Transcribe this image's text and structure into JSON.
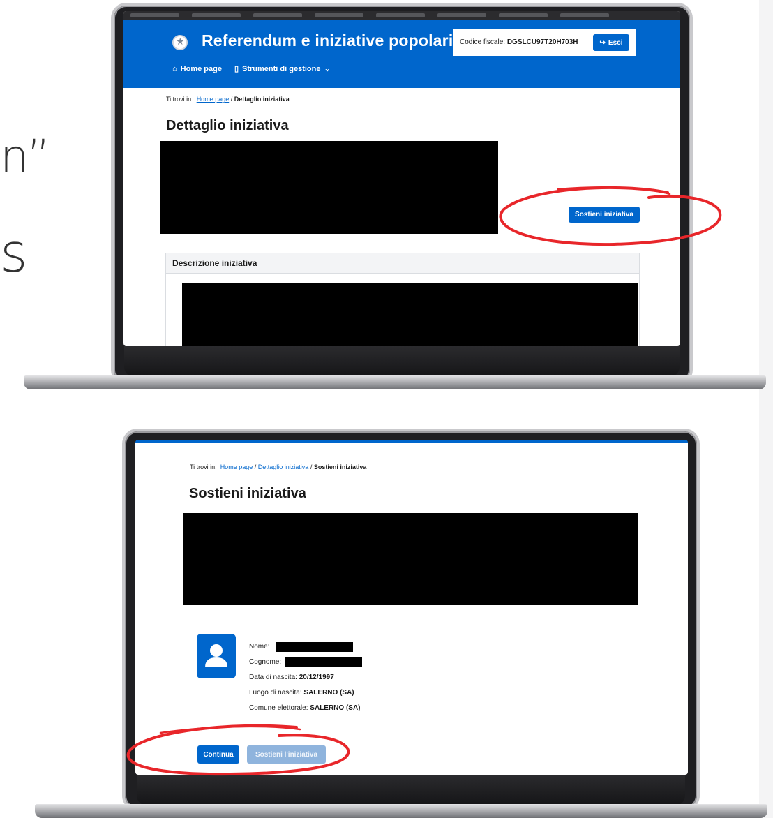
{
  "left_fragments": {
    "quote": "n”",
    "letter": "s"
  },
  "top_screen": {
    "app_title": "Referendum e iniziative popolari",
    "codice_fiscale_label": "Codice fiscale:",
    "codice_fiscale_value": "DGSLCU97T20H703H",
    "logout_label": "Esci",
    "nav": {
      "home": "Home page",
      "tools": "Strumenti di gestione"
    },
    "breadcrumb": {
      "prefix": "Ti trovi in:",
      "home": "Home page",
      "sep": "/",
      "current": "Dettaglio iniziativa"
    },
    "page_title": "Dettaglio iniziativa",
    "support_button": "Sostieni iniziativa",
    "description_header": "Descrizione iniziativa"
  },
  "bottom_screen": {
    "breadcrumb": {
      "prefix": "Ti trovi in:",
      "home": "Home page",
      "sep": "/",
      "middle": "Dettaglio iniziativa",
      "current": "Sostieni iniziativa"
    },
    "page_title": "Sostieni iniziativa",
    "person": {
      "nome_label": "Nome:",
      "cognome_label": "Cognome:",
      "nascita_label": "Data di nascita:",
      "nascita_value": "20/12/1997",
      "luogo_label": "Luogo di nascita:",
      "luogo_value": "SALERNO (SA)",
      "comune_label": "Comune elettorale:",
      "comune_value": "SALERNO (SA)"
    },
    "continue_button": "Continua",
    "support_button": "Sostieni l'iniziativa"
  },
  "colors": {
    "primary": "#0066cc",
    "annotation": "#e8262a",
    "disabled": "#8fb4dd"
  },
  "icons": [
    "home-icon",
    "mobile-icon",
    "chevron-down-icon",
    "logout-icon",
    "contact-card-icon",
    "emblem-icon"
  ]
}
